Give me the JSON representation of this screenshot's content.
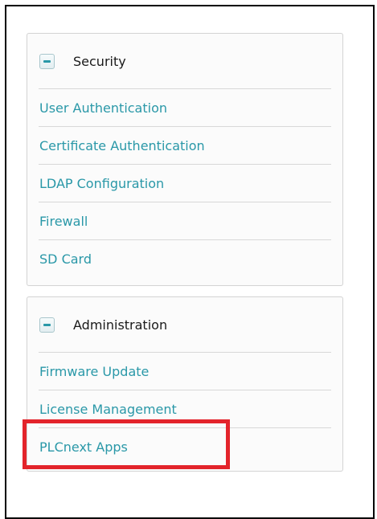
{
  "security": {
    "title": "Security",
    "items": [
      {
        "label": "User Authentication"
      },
      {
        "label": "Certificate Authentication"
      },
      {
        "label": "LDAP Configuration"
      },
      {
        "label": "Firewall"
      },
      {
        "label": "SD Card"
      }
    ]
  },
  "administration": {
    "title": "Administration",
    "items": [
      {
        "label": "Firmware Update"
      },
      {
        "label": "License Management"
      },
      {
        "label": "PLCnext Apps"
      }
    ]
  },
  "colors": {
    "link": "#2a98a8",
    "highlight": "#e3242b",
    "border": "#d4d4d4"
  },
  "icons": {
    "collapse": "minus-icon"
  }
}
